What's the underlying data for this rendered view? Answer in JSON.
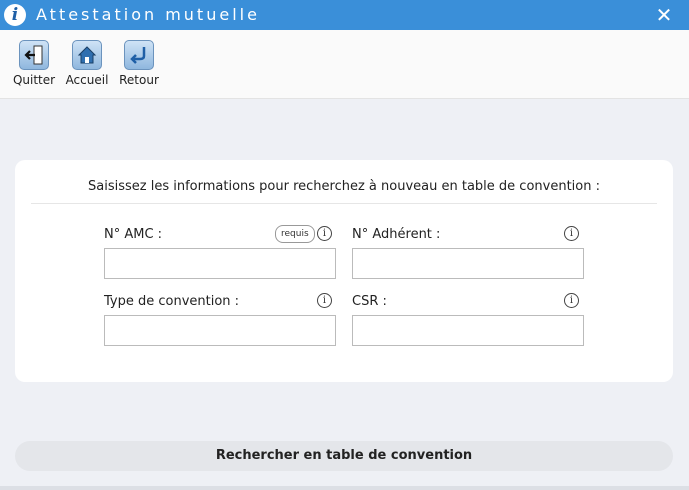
{
  "window": {
    "title": "Attestation mutuelle",
    "info_glyph": "i",
    "close_glyph": "✕"
  },
  "toolbar": {
    "items": [
      {
        "label": "Quitter",
        "icon": "exit-icon"
      },
      {
        "label": "Accueil",
        "icon": "home-icon"
      },
      {
        "label": "Retour",
        "icon": "back-arrow-icon"
      }
    ]
  },
  "form": {
    "header": "Saisissez les informations pour recherchez à nouveau en table de convention :",
    "required_badge": "requis",
    "info_glyph": "i",
    "fields": [
      {
        "label": "N° AMC :",
        "value": "",
        "required": true
      },
      {
        "label": "N° Adhérent :",
        "value": ""
      },
      {
        "label": "Type de convention :",
        "value": ""
      },
      {
        "label": "CSR :",
        "value": ""
      }
    ]
  },
  "actions": {
    "search_label": "Rechercher en table de convention"
  },
  "colors": {
    "titlebar": "#3a8fd9",
    "background": "#eef0f5",
    "card": "#ffffff"
  }
}
